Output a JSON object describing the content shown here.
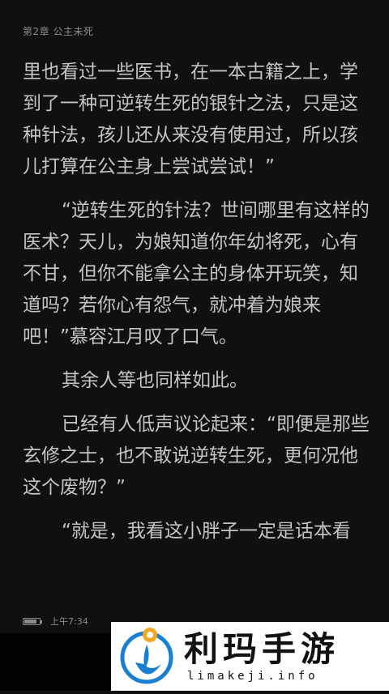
{
  "reader": {
    "chapter_title": "第2章 公主未死",
    "paragraphs": [
      "里也看过一些医书，在一本古籍之上，学到了一种可逆转生死的银针之法，只是这种针法，孩儿还从来没有使用过，所以孩儿打算在公主身上尝试尝试！”",
      "“逆转生死的针法？世间哪里有这样的医术？天儿，为娘知道你年幼将死，心有不甘，但你不能拿公主的身体开玩笑，知道吗？若你心有怨气，就冲着为娘来吧！”慕容江月叹了口气。",
      "其余人等也同样如此。",
      "已经有人低声议论起来：“即便是那些玄修之士，也不敢说逆转生死，更何况他这个废物？”",
      "“就是，我看这小胖子一定是话本看"
    ]
  },
  "status_bar": {
    "time": "上午7:34",
    "battery_level": 0.85
  },
  "watermark": {
    "cn": "利玛手游",
    "en": "limakeji.info"
  },
  "colors": {
    "background": "#101010",
    "text": "#c4c4c4",
    "meta": "#8a8a8a",
    "logo_orange": "#f5a623",
    "logo_blue": "#1a7fd0"
  }
}
